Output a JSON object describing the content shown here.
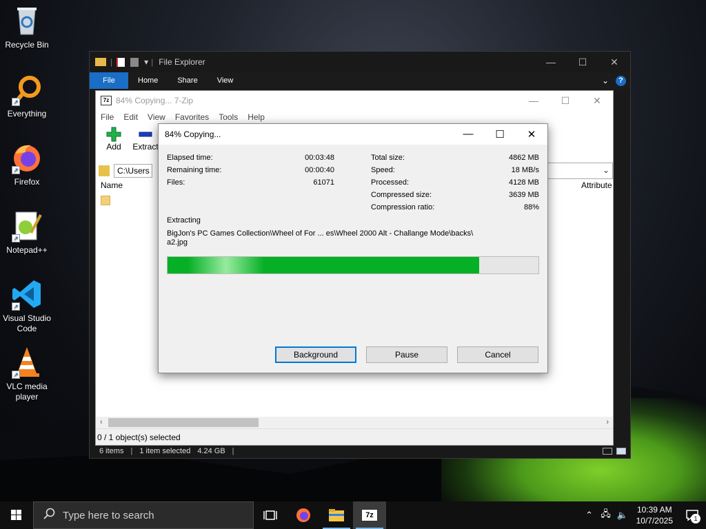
{
  "desktop": {
    "icons": [
      {
        "label": "Recycle Bin"
      },
      {
        "label": "Everything"
      },
      {
        "label": "Firefox"
      },
      {
        "label": "Notepad++"
      },
      {
        "label": "Visual Studio Code"
      },
      {
        "label": "VLC media player"
      }
    ]
  },
  "explorer": {
    "title": "File Explorer",
    "tabs": [
      "File",
      "Home",
      "Share",
      "View"
    ],
    "status": {
      "items": "6 items",
      "selected": "1 item selected",
      "size": "4.24 GB"
    }
  },
  "zip": {
    "title": "84% Copying... 7-Zip",
    "menu": [
      "File",
      "Edit",
      "View",
      "Favorites",
      "Tools",
      "Help"
    ],
    "toolbar": {
      "add": "Add",
      "extract": "Extract"
    },
    "address": "C:\\Users",
    "columns": {
      "name": "Name",
      "attributes": "Attribute"
    },
    "status": "0 / 1 object(s) selected"
  },
  "dialog": {
    "title": "84% Copying...",
    "elapsed_label": "Elapsed time:",
    "elapsed_value": "00:03:48",
    "remaining_label": "Remaining time:",
    "remaining_value": "00:00:40",
    "files_label": "Files:",
    "files_value": "61071",
    "total_label": "Total size:",
    "total_value": "4862 MB",
    "speed_label": "Speed:",
    "speed_value": "18 MB/s",
    "processed_label": "Processed:",
    "processed_value": "4128 MB",
    "compressed_label": "Compressed size:",
    "compressed_value": "3639 MB",
    "ratio_label": "Compression ratio:",
    "ratio_value": "88%",
    "action": "Extracting",
    "path_line1": "BigJon's PC Games Collection\\Wheel of For ... es\\Wheel 2000 Alt - Challange Mode\\backs\\",
    "path_line2": "a2.jpg",
    "progress": 0.84,
    "buttons": {
      "background": "Background",
      "pause": "Pause",
      "cancel": "Cancel"
    }
  },
  "taskbar": {
    "search_placeholder": "Type here to search",
    "time": "10:39 AM",
    "date": "10/7/2025",
    "notification_count": "1",
    "apps": [
      "task-view",
      "firefox",
      "file-explorer",
      "7-zip"
    ]
  },
  "colors": {
    "accent": "#1a6ec5",
    "progress": "#06b025",
    "focus": "#0078d7"
  }
}
